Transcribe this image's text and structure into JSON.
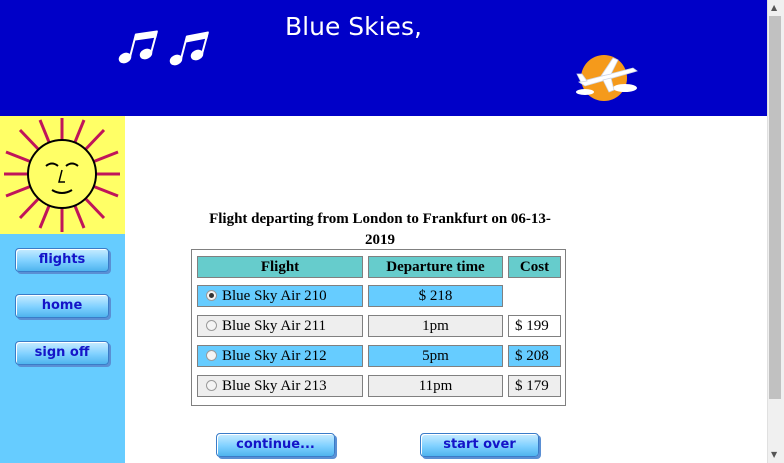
{
  "header": {
    "brand": "Blue Skies,"
  },
  "sidebar": {
    "items": [
      {
        "label": "flights"
      },
      {
        "label": "home"
      },
      {
        "label": "sign off"
      }
    ]
  },
  "main": {
    "title": "Flight departing from London to Frankfurt on 06-13-2019",
    "table": {
      "headers": [
        "Flight",
        "Departure time",
        "Cost"
      ],
      "rows": [
        {
          "flight": "Blue Sky Air 210",
          "departure": "$ 218",
          "cost": "",
          "selected": true
        },
        {
          "flight": "Blue Sky Air 211",
          "departure": "1pm",
          "cost": "$ 199",
          "selected": false
        },
        {
          "flight": "Blue Sky Air 212",
          "departure": "5pm",
          "cost": "$ 208",
          "selected": false
        },
        {
          "flight": "Blue Sky Air 213",
          "departure": "11pm",
          "cost": "$ 179",
          "selected": false
        }
      ]
    },
    "buttons": {
      "continue": "continue...",
      "start_over": "start over"
    }
  },
  "icons": [
    "music-notes-icon",
    "airplane-sun-icon",
    "sun-face-icon",
    "radio-icon"
  ],
  "colors": {
    "header": "#0000c8",
    "sidebar": "#66ccff",
    "row_highlight": "#66ccff",
    "header_cell": "#66cccc"
  }
}
